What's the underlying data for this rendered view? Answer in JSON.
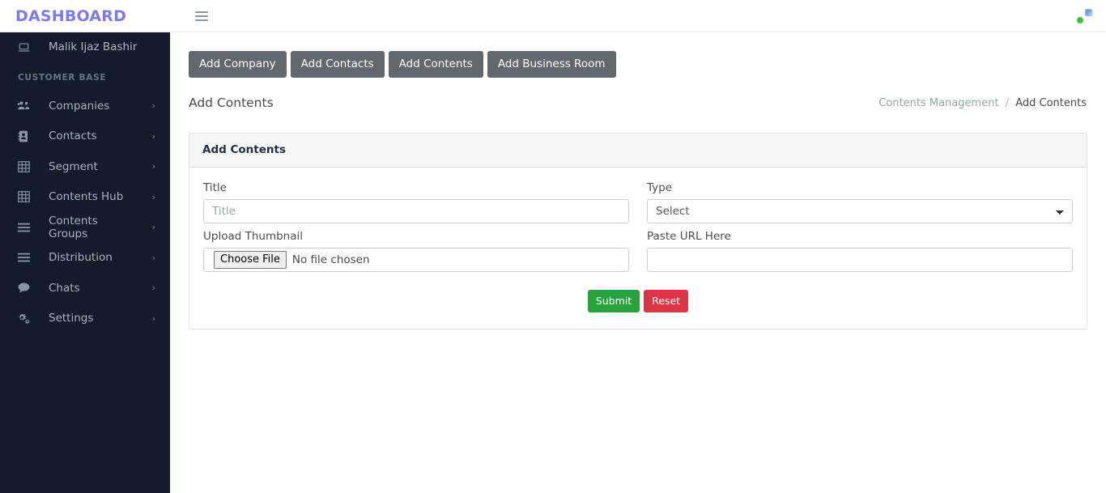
{
  "topbar": {
    "brand": "DASHBOARD",
    "menu_toggle_icon": "hamburger-icon",
    "user_name": "",
    "status": "online"
  },
  "sidebar": {
    "user": {
      "name": "Malik Ijaz Bashir",
      "icon": "laptop-icon"
    },
    "section_heading": "CUSTOMER BASE",
    "items": [
      {
        "label": "Companies",
        "icon": "users-group-icon",
        "chevron": "›"
      },
      {
        "label": "Contacts",
        "icon": "address-book-icon",
        "chevron": "›"
      },
      {
        "label": "Segment",
        "icon": "table-grid-icon",
        "chevron": "›"
      },
      {
        "label": "Contents Hub",
        "icon": "table-grid-icon",
        "chevron": "›"
      },
      {
        "label": "Contents Groups",
        "icon": "list-lines-icon",
        "chevron": "›"
      },
      {
        "label": "Distribution",
        "icon": "list-lines-icon",
        "chevron": "›"
      },
      {
        "label": "Chats",
        "icon": "chat-bubble-icon",
        "chevron": "›"
      },
      {
        "label": "Settings",
        "icon": "gears-icon",
        "chevron": "›"
      }
    ]
  },
  "actions": [
    {
      "label": "Add Company"
    },
    {
      "label": "Add Contacts"
    },
    {
      "label": "Add Contents"
    },
    {
      "label": "Add Business Room"
    }
  ],
  "page": {
    "title": "Add Contents",
    "breadcrumb": {
      "parent": "Contents Management",
      "separator": "/",
      "current": "Add Contents"
    }
  },
  "card": {
    "header": "Add Contents",
    "fields": {
      "title": {
        "label": "Title",
        "placeholder": "Title",
        "value": ""
      },
      "type": {
        "label": "Type",
        "selected": "Select",
        "options": [
          "Select"
        ]
      },
      "thumbnail": {
        "label": "Upload Thumbnail",
        "button": "Choose File",
        "status": "No file chosen"
      },
      "url": {
        "label": "Paste URL Here",
        "placeholder": "",
        "value": ""
      }
    },
    "buttons": {
      "submit": "Submit",
      "reset": "Reset"
    }
  },
  "colors": {
    "brand": "#7b7bea",
    "sidebar_bg": "#141c2b",
    "action_btn": "#61696f",
    "submit_green": "#2aa13f",
    "reset_red": "#dc3545",
    "online_green": "#3fbf3f"
  }
}
